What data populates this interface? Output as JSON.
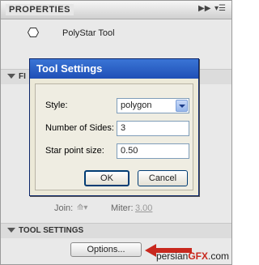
{
  "panel": {
    "title": "PROPERTIES",
    "tool_name": "PolyStar Tool",
    "section_fill_stroke_prefix": "FI",
    "join_label": "Join:",
    "miter_label": "Miter:",
    "miter_value": "3.00",
    "tool_settings_label": "TOOL SETTINGS",
    "options_button": "Options..."
  },
  "dialog": {
    "title": "Tool Settings",
    "style_label": "Style:",
    "style_value": "polygon",
    "sides_label": "Number of Sides:",
    "sides_value": "3",
    "star_label": "Star point size:",
    "star_value": "0.50",
    "ok_label": "OK",
    "cancel_label": "Cancel"
  },
  "watermark": {
    "prefix": "persian",
    "brand": "GFX",
    "suffix": ".com"
  },
  "colors": {
    "dialog_title_bg": "#1f4fb6",
    "arrow": "#c8281e"
  }
}
